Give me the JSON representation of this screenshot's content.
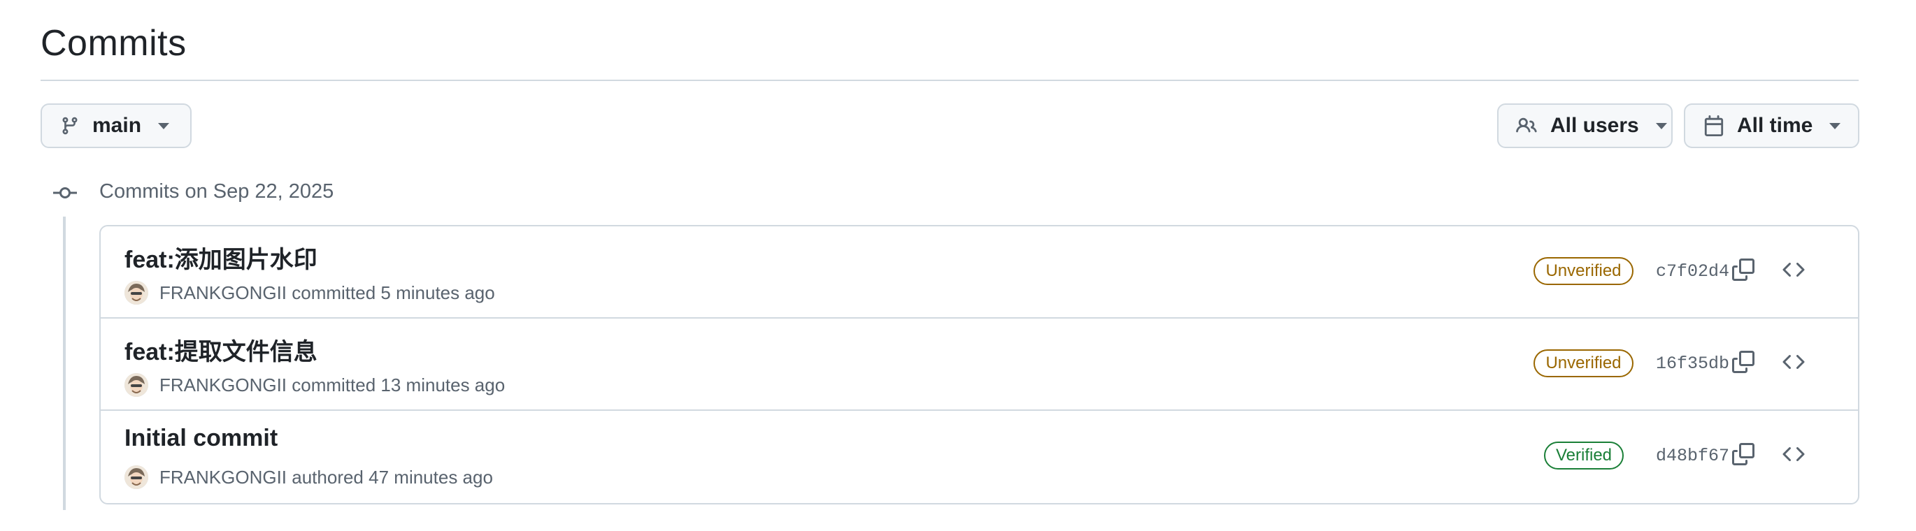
{
  "page": {
    "title": "Commits"
  },
  "filters": {
    "branch": {
      "label": "main",
      "icon": "git-branch-icon"
    },
    "users": {
      "label": "All users",
      "icon": "people-icon"
    },
    "time": {
      "label": "All time",
      "icon": "calendar-icon"
    }
  },
  "group": {
    "date_label": "Commits on Sep 22, 2025",
    "icon": "git-commit-icon"
  },
  "commits": [
    {
      "message": "feat:添加图片水印",
      "author": "FRANKGONGII",
      "action": "committed",
      "time": "5 minutes ago",
      "badge": "Unverified",
      "sha": "c7f02d4"
    },
    {
      "message": "feat:提取文件信息",
      "author": "FRANKGONGII",
      "action": "committed",
      "time": "13 minutes ago",
      "badge": "Unverified",
      "sha": "16f35db"
    },
    {
      "message": "Initial commit",
      "author": "FRANKGONGII",
      "action": "authored",
      "time": "47 minutes ago",
      "badge": "Verified",
      "sha": "d48bf67"
    }
  ],
  "colors": {
    "text": "#1f2328",
    "muted": "#59636e",
    "border": "#d1d9e0",
    "button_bg": "#f6f8fa",
    "unverified": "#9a6700",
    "verified": "#1a7f37"
  }
}
